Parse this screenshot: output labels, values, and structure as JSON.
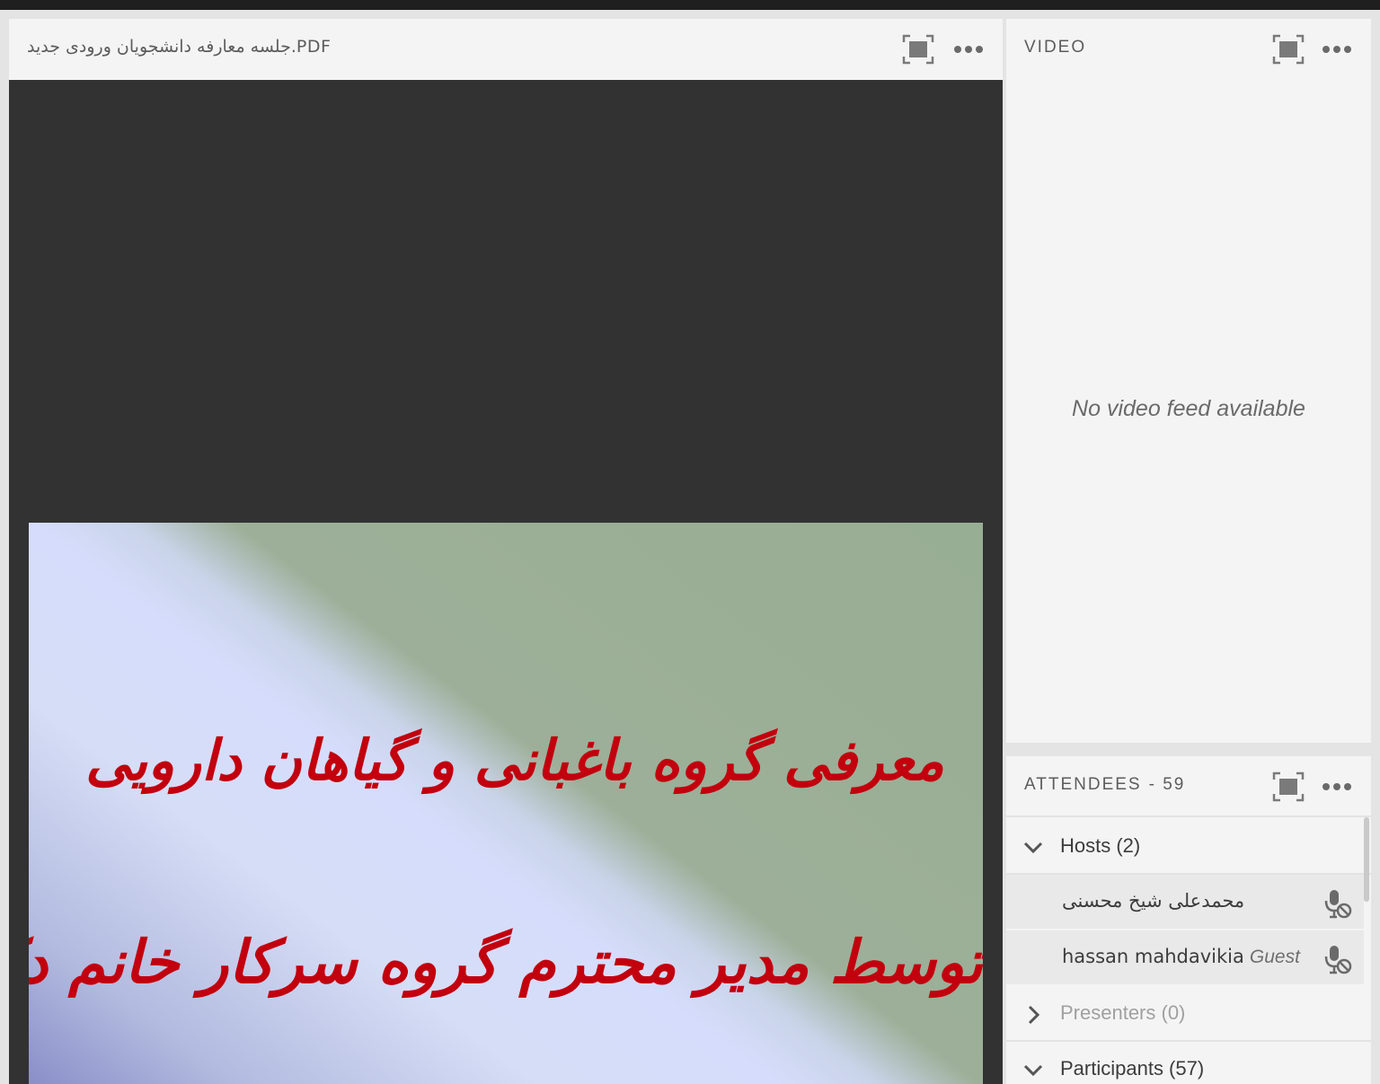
{
  "share_pod": {
    "title": "جلسه معارفه دانشجویان ورودی جدید.PDF",
    "fullscreen_icon": "maximize-icon",
    "menu_icon": "more-options-icon",
    "slide": {
      "line1": "معرفی گروه باغبانی و گیاهان دارویی",
      "line2": "توسط مدیر محترم گروه سرکار خانم دکتر فتحی"
    }
  },
  "video_pod": {
    "title": "VIDEO",
    "empty_message": "No video feed available",
    "fullscreen_icon": "maximize-icon",
    "menu_icon": "more-options-icon"
  },
  "attendees_pod": {
    "title": "ATTENDEES",
    "count": "- 59",
    "fullscreen_icon": "maximize-icon",
    "menu_icon": "more-options-icon",
    "groups": [
      {
        "label": "Hosts (2)",
        "expanded": true,
        "members": [
          {
            "name": "محمدعلی شیخ محسنی",
            "role": "",
            "mic": "mic-disabled-icon"
          },
          {
            "name": "hassan mahdavikia",
            "role": "Guest",
            "mic": "mic-disabled-icon"
          }
        ]
      },
      {
        "label": "Presenters (0)",
        "expanded": false,
        "members": []
      },
      {
        "label": "Participants (57)",
        "expanded": true,
        "members": []
      }
    ]
  },
  "colors": {
    "pod_background": "#f4f4f4",
    "stage_background": "#323232",
    "slide_text": "#c2000e",
    "header_text": "#5c5c5c"
  }
}
